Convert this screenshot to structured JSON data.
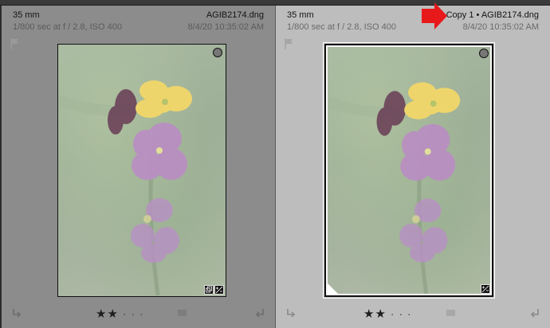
{
  "cells": [
    {
      "focal": "35 mm",
      "filename": "AGIB2174.dng",
      "exposure": "1/800 sec at f / 2.8, ISO 400",
      "date": "8/4/20 10:35:02 AM",
      "rating": "★★",
      "rating_dots": "· · ·"
    },
    {
      "focal": "35 mm",
      "filename": "Copy 1  •  AGIB2174.dng",
      "exposure": "1/800 sec at f / 2.8, ISO 400",
      "date": "8/4/20 10:35:02 AM",
      "rating": "★★",
      "rating_dots": "· · ·"
    }
  ],
  "colors": {
    "arrow": "#e8191a",
    "unselected_cell": "#8c8c8c",
    "selected_cell": "#bdbdbd"
  },
  "icons": [
    "flag-icon",
    "rotate-left-icon",
    "rotate-right-icon",
    "quick-collection-circle-icon",
    "virtual-copy-badge-icon",
    "develop-adjustment-badge-icon",
    "red-arrow-icon"
  ]
}
